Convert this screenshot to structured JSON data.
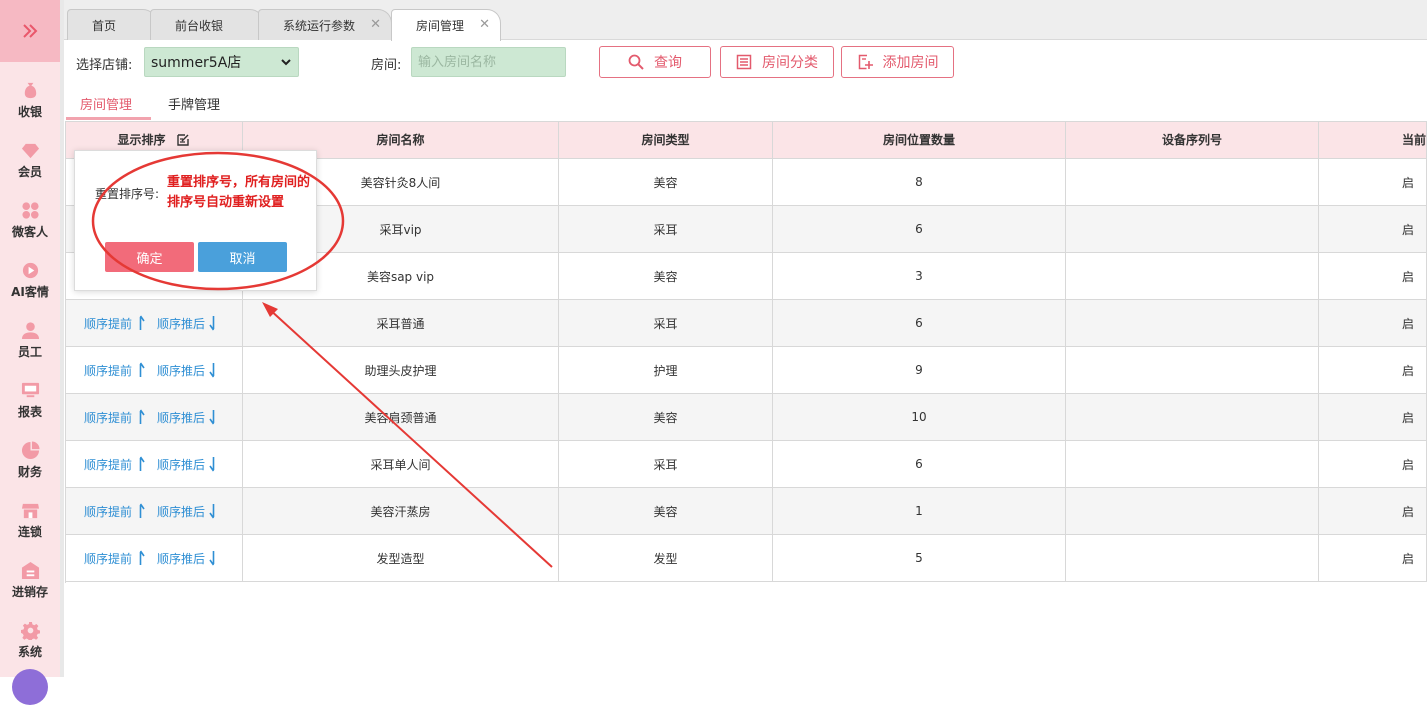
{
  "sidebar": {
    "toggle_icon": "double-chevron-right-icon",
    "items": [
      {
        "label": "收银",
        "icon": "money-bag-icon"
      },
      {
        "label": "会员",
        "icon": "diamond-icon"
      },
      {
        "label": "微客人",
        "icon": "grid-icon"
      },
      {
        "label": "AI客情",
        "icon": "play-circle-icon"
      },
      {
        "label": "员工",
        "icon": "person-icon"
      },
      {
        "label": "报表",
        "icon": "monitor-icon"
      },
      {
        "label": "财务",
        "icon": "pie-chart-icon"
      },
      {
        "label": "连锁",
        "icon": "store-icon"
      },
      {
        "label": "进销存",
        "icon": "warehouse-icon"
      },
      {
        "label": "系统",
        "icon": "gear-icon"
      }
    ],
    "accent": "#e9576b"
  },
  "tabs": [
    {
      "label": "首页",
      "closable": false
    },
    {
      "label": "前台收银",
      "closable": false
    },
    {
      "label": "系统运行参数",
      "closable": true
    },
    {
      "label": "房间管理",
      "closable": true,
      "active": true
    }
  ],
  "filters": {
    "store_label": "选择店铺:",
    "store_value": "summer5A店",
    "room_label": "房间:",
    "room_placeholder": "输入房间名称"
  },
  "actions": {
    "search": "查询",
    "category": "房间分类",
    "add": "添加房间"
  },
  "subtabs": [
    {
      "label": "房间管理",
      "active": true
    },
    {
      "label": "手牌管理",
      "active": false
    }
  ],
  "table": {
    "headers": [
      "显示排序",
      "房间名称",
      "房间类型",
      "房间位置数量",
      "设备序列号",
      "当前"
    ],
    "sort_up_label": "顺序提前",
    "sort_down_label": "顺序推后",
    "rows": [
      {
        "name": "美容针灸8人间",
        "type": "美容",
        "seats": "8",
        "serial": "",
        "status": "启"
      },
      {
        "name": "采耳vip",
        "type": "采耳",
        "seats": "6",
        "serial": "",
        "status": "启"
      },
      {
        "name": "美容sap vip",
        "type": "美容",
        "seats": "3",
        "serial": "",
        "status": "启"
      },
      {
        "name": "采耳普通",
        "type": "采耳",
        "seats": "6",
        "serial": "",
        "status": "启"
      },
      {
        "name": "助理头皮护理",
        "type": "护理",
        "seats": "9",
        "serial": "",
        "status": "启"
      },
      {
        "name": "美容肩颈普通",
        "type": "美容",
        "seats": "10",
        "serial": "",
        "status": "启"
      },
      {
        "name": "采耳单人间",
        "type": "采耳",
        "seats": "6",
        "serial": "",
        "status": "启"
      },
      {
        "name": "美容汗蒸房",
        "type": "美容",
        "seats": "1",
        "serial": "",
        "status": "启"
      },
      {
        "name": "发型造型",
        "type": "发型",
        "seats": "5",
        "serial": "",
        "status": "启"
      }
    ]
  },
  "popup": {
    "label": "重置排序号:",
    "message": "重置排序号，所有房间的排序号自动重新设置",
    "ok": "确定",
    "cancel": "取消"
  },
  "colors": {
    "primary": "#e35a6d",
    "header_bg": "#fbe4e7",
    "cancel_blue": "#4aa0db",
    "link_blue": "#2f8fd4",
    "annotation_red": "#e53935"
  }
}
